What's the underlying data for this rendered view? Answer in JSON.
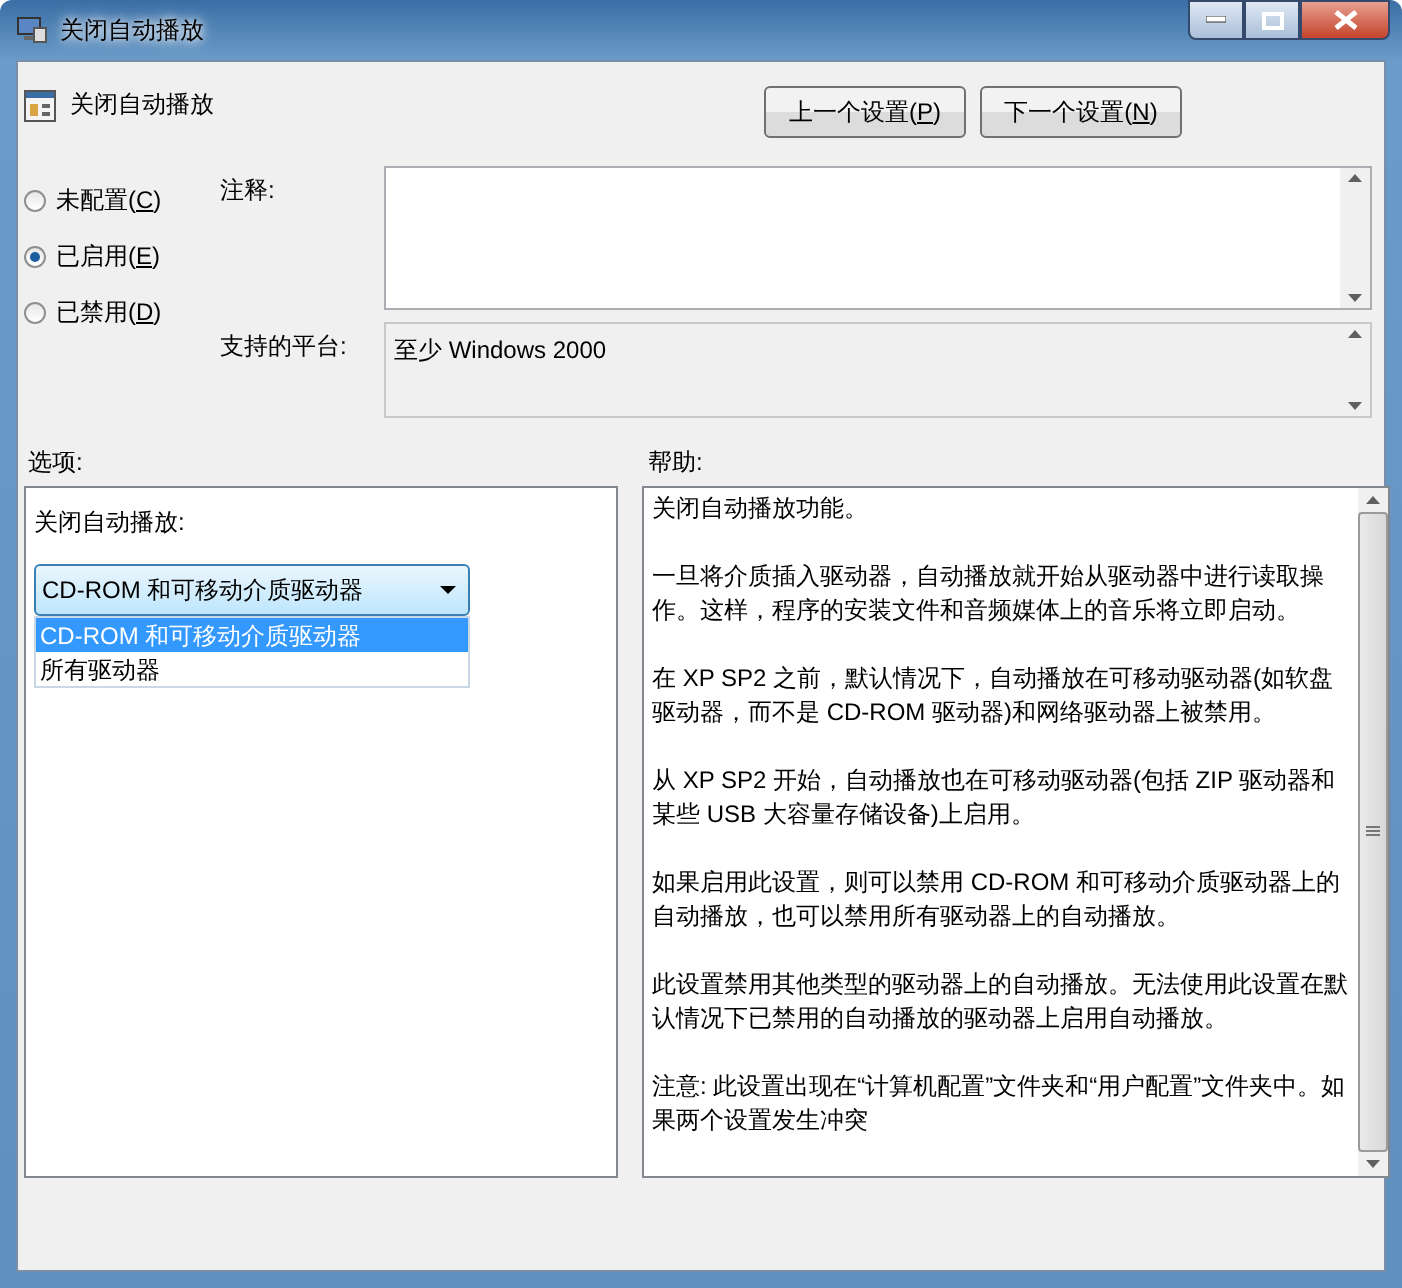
{
  "window": {
    "title": "关闭自动播放"
  },
  "policy_title": "关闭自动播放",
  "nav_buttons": [
    {
      "before": "上一个设置(",
      "access_key": "P",
      "after": ")"
    },
    {
      "before": "下一个设置(",
      "access_key": "N",
      "after": ")"
    }
  ],
  "state_options": [
    {
      "before": "未配置(",
      "access_key": "C",
      "after": ")",
      "selected": false
    },
    {
      "before": "已启用(",
      "access_key": "E",
      "after": ")",
      "selected": true
    },
    {
      "before": "已禁用(",
      "access_key": "D",
      "after": ")",
      "selected": false
    }
  ],
  "comment": {
    "label": "注释:"
  },
  "supported_platforms": {
    "label": "支持的平台:",
    "value": "至少 Windows 2000"
  },
  "options": {
    "heading": "选项:",
    "dropdown_label": "关闭自动播放:",
    "dropdown": {
      "value": "CD-ROM 和可移动介质驱动器",
      "expanded": true,
      "items": [
        {
          "label": "CD-ROM 和可移动介质驱动器",
          "selected": true
        },
        {
          "label": "所有驱动器",
          "selected": false
        }
      ]
    }
  },
  "help": {
    "heading": "帮助:",
    "paragraphs": [
      "关闭自动播放功能。",
      "一旦将介质插入驱动器，自动播放就开始从驱动器中进行读取操作。这样，程序的安装文件和音频媒体上的音乐将立即启动。",
      "在 XP SP2 之前，默认情况下，自动播放在可移动驱动器(如软盘驱动器，而不是 CD-ROM 驱动器)和网络驱动器上被禁用。",
      "从 XP SP2 开始，自动播放也在可移动驱动器(包括 ZIP 驱动器和某些 USB 大容量存储设备)上启用。",
      "如果启用此设置，则可以禁用 CD-ROM 和可移动介质驱动器上的自动播放，也可以禁用所有驱动器上的自动播放。",
      "此设置禁用其他类型的驱动器上的自动播放。无法使用此设置在默认情况下已禁用的自动播放的驱动器上启用自动播放。",
      "注意: 此设置出现在“计算机配置”文件夹和“用户配置”文件夹中。如果两个设置发生冲突"
    ]
  }
}
